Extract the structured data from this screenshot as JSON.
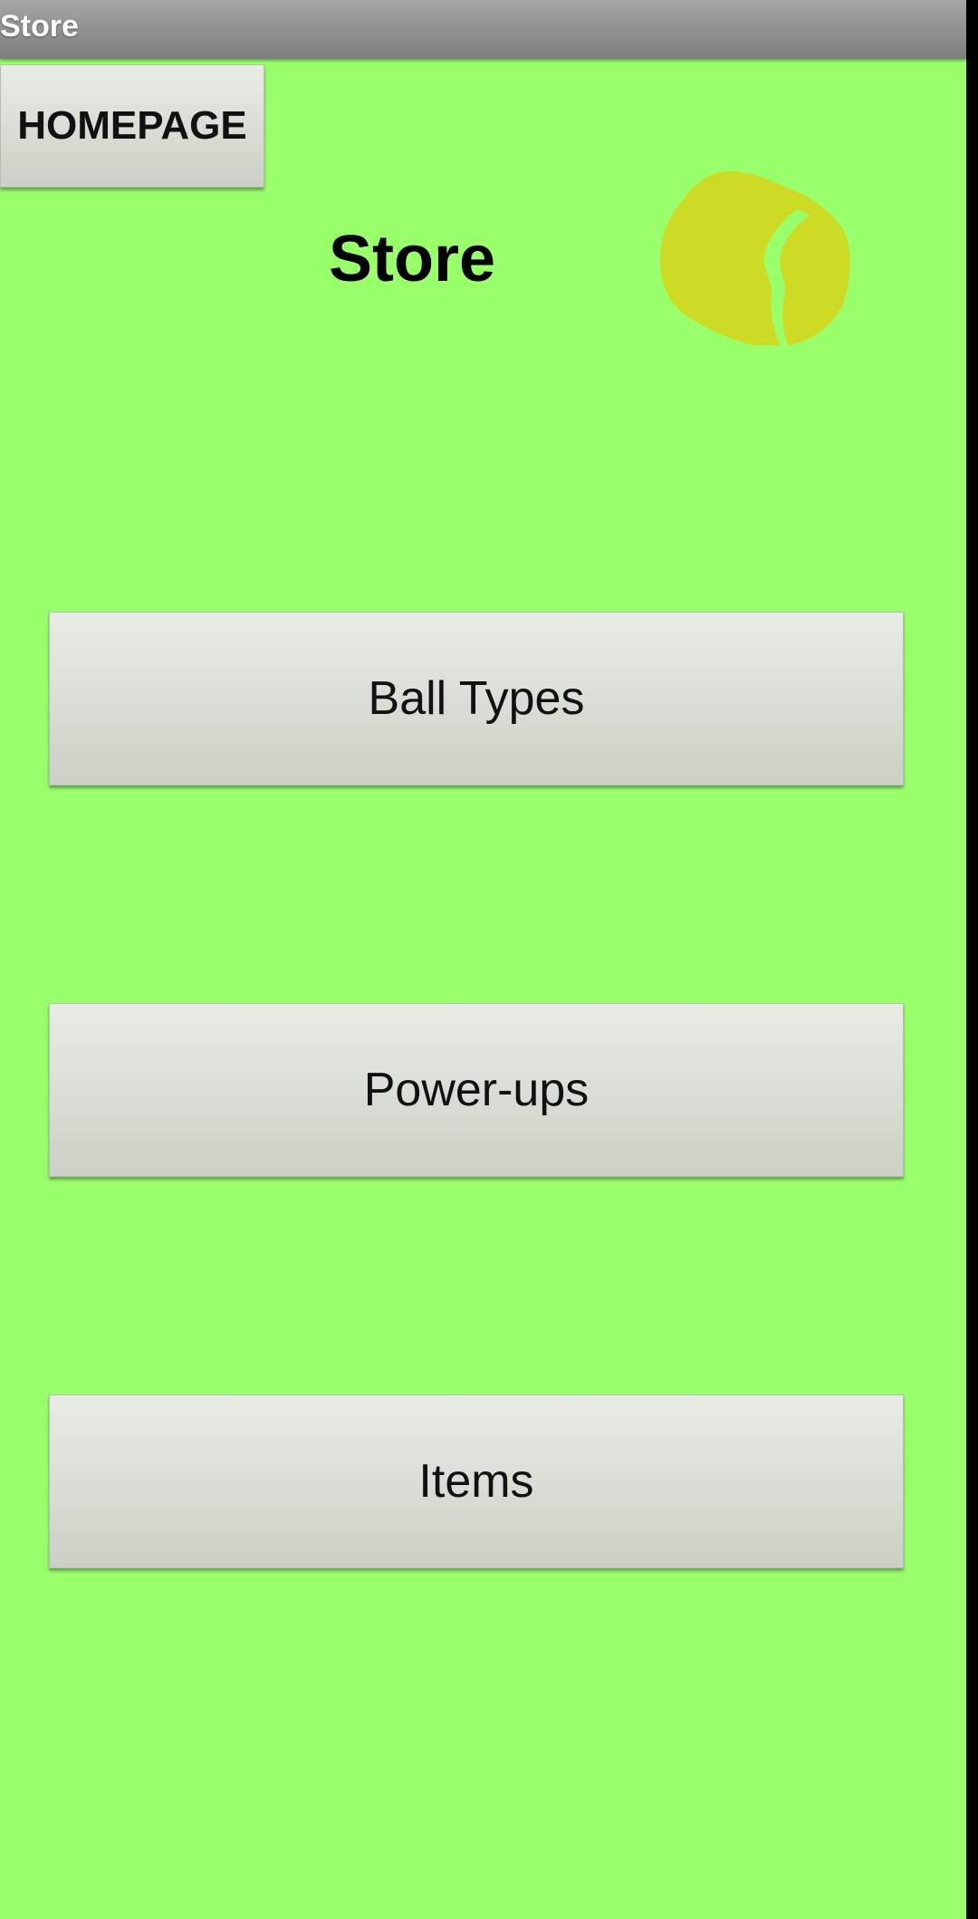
{
  "window": {
    "title": "Store"
  },
  "header": {
    "home_button_label": "HOMEPAGE",
    "page_title": "Store"
  },
  "logo": {
    "icon": "tennis-ball-icon",
    "color": "#cddb24"
  },
  "menu": {
    "ball_types_label": "Ball Types",
    "power_ups_label": "Power-ups",
    "items_label": "Items"
  },
  "colors": {
    "background": "#99ff6b",
    "button": "#dde1d8",
    "titlebar": "#8f8f8f"
  }
}
